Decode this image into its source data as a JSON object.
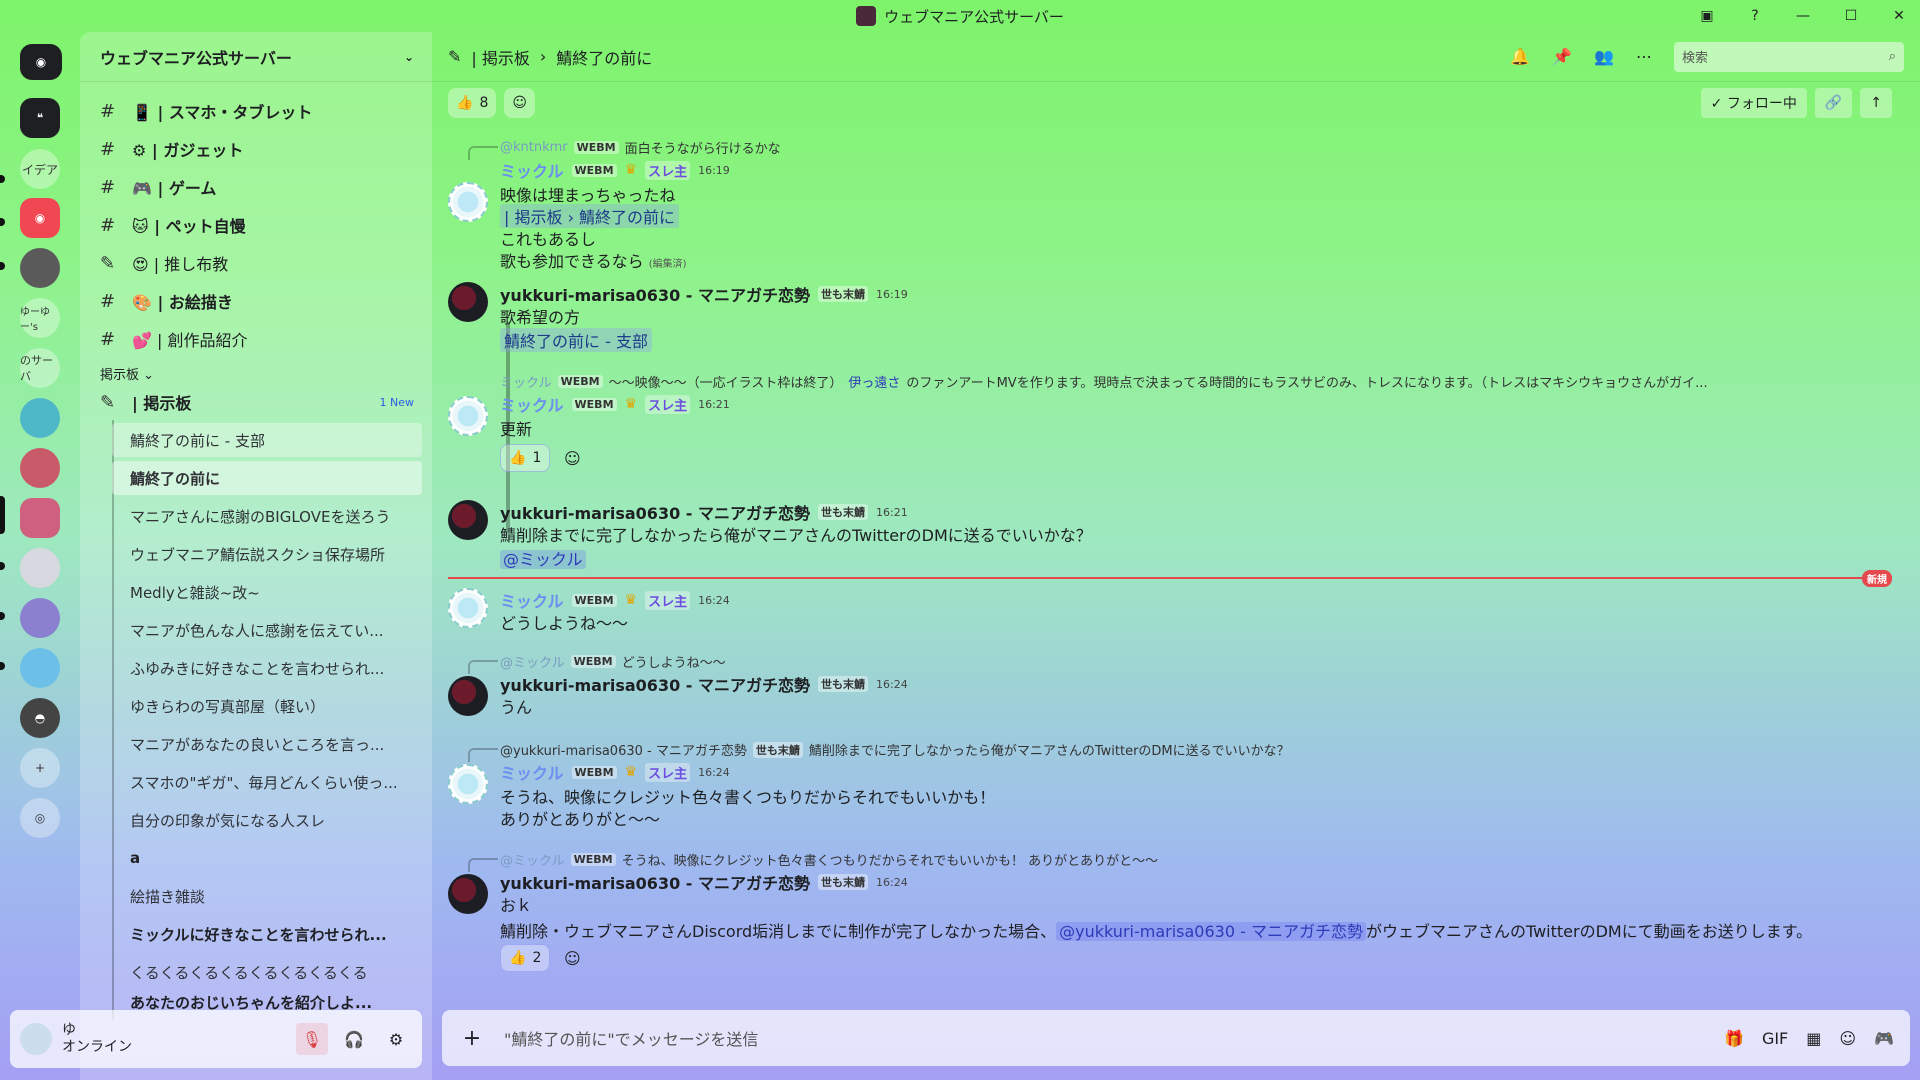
{
  "window": {
    "title": "ウェブマニア公式サーバー"
  },
  "servers": {
    "labels": [
      "イデア",
      "ゆーゆー's",
      "のサーバ"
    ]
  },
  "server": {
    "name": "ウェブマニア公式サーバー"
  },
  "channels": [
    {
      "icon": "#",
      "name": "📱 | スマホ・タブレット"
    },
    {
      "icon": "#",
      "name": "⚙ | ガジェット"
    },
    {
      "icon": "#",
      "name": "🎮 | ゲーム"
    },
    {
      "icon": "#",
      "name": "🐱 | ペット自慢"
    },
    {
      "icon": "forum",
      "name": "😍 | 推し布教"
    },
    {
      "icon": "#",
      "name": "🎨 | お絵描き"
    },
    {
      "icon": "#",
      "name": "💕 | 創作品紹介"
    }
  ],
  "category": "掲示板 ⌄",
  "forum": {
    "name": "| 掲示板",
    "badge": "1 New"
  },
  "threads": [
    "鯖終了の前に - 支部",
    "鯖終了の前に",
    "マニアさんに感謝のBIGLOVEを送ろう",
    "ウェブマニア鯖伝説スクショ保存場所",
    "Medlyと雑談~改~",
    "マニアが色んな人に感謝を伝えてい...",
    "ふゆみきに好きなことを言わせられ...",
    "ゆきらわの写真部屋（軽い）",
    "マニアがあなたの良いところを言っ...",
    "スマホの\"ギガ\"、毎月どんくらい使っ...",
    "自分の印象が気になる人スレ",
    "a",
    "絵描き雑談",
    "ミックルに好きなことを言わせられ...",
    "くるくるくるくるくるくるくるくる",
    "あなたのおじいちゃんを紹介しよ..."
  ],
  "user": {
    "name": "ゆ",
    "status": "オンライン"
  },
  "header": {
    "forum": "| 掲示板",
    "sep": "›",
    "thread": "鯖終了の前に",
    "search_placeholder": "検索"
  },
  "topbar": {
    "like": "👍",
    "like_count": "8",
    "follow": "✓ フォロー中"
  },
  "messages": {
    "m1": {
      "reply_name": "@kntnkmr",
      "reply_tag": "WEBM",
      "reply_text": "面白そうながら行けるかな",
      "name": "ミックル",
      "tag": "WEBM",
      "sure": "スレ主",
      "time": "16:19",
      "l1": "映像は埋まっちゃったね",
      "chip": "| 掲示板 › 鯖終了の前に",
      "l2": "これもあるし",
      "l3": "歌も参加できるなら",
      "edited": "(編集済)"
    },
    "m2": {
      "name": "yukkuri-marisa0630 - マニアガチ恋勢",
      "tag": "世も末鯖",
      "time": "16:19",
      "l1": "歌希望の方",
      "chip": "鯖終了の前に - 支部"
    },
    "m3": {
      "reply_name": "ミックル",
      "reply_tag": "WEBM",
      "reply_text": "〜〜映像〜〜（一応イラスト枠は終了）",
      "reply_link": "伊っ遠さ",
      "reply_rest": "のファンアートMVを作ります。現時点で決まってる時間的にもラスサビのみ、トレスになります。（トレスはマキシウキョウさんがガイ...",
      "name": "ミックル",
      "tag": "WEBM",
      "sure": "スレ主",
      "time": "16:21",
      "l1": "更新",
      "react": "👍",
      "react_count": "1"
    },
    "m4": {
      "name": "yukkuri-marisa0630 - マニアガチ恋勢",
      "tag": "世も末鯖",
      "time": "16:21",
      "l1": "鯖削除までに完了しなかったら俺がマニアさんのTwitterのDMに送るでいいかな？",
      "mention": "@ミックル"
    },
    "new": "新規",
    "m5": {
      "name": "ミックル",
      "tag": "WEBM",
      "sure": "スレ主",
      "time": "16:24",
      "l1": "どうしようね〜〜"
    },
    "m6": {
      "reply_name": "@ミックル",
      "reply_tag": "WEBM",
      "reply_text": "どうしようね〜〜",
      "name": "yukkuri-marisa0630 - マニアガチ恋勢",
      "tag": "世も末鯖",
      "time": "16:24",
      "l1": "うん"
    },
    "m7": {
      "reply_name": "@yukkuri-marisa0630 - マニアガチ恋勢",
      "reply_tag": "世も末鯖",
      "reply_text": "鯖削除までに完了しなかったら俺がマニアさんのTwitterのDMに送るでいいかな？",
      "name": "ミックル",
      "tag": "WEBM",
      "sure": "スレ主",
      "time": "16:24",
      "l1": "そうね、映像にクレジット色々書くつもりだからそれでもいいかも！",
      "l2": "ありがとありがと〜〜"
    },
    "m8": {
      "reply_name": "@ミックル",
      "reply_tag": "WEBM",
      "reply_text": "そうね、映像にクレジット色々書くつもりだからそれでもいいかも！ ありがとありがと〜〜",
      "name": "yukkuri-marisa0630 - マニアガチ恋勢",
      "tag": "世も末鯖",
      "time": "16:24",
      "l1": "おｋ",
      "l2a": "鯖削除・ウェブマニアさんDiscord垢消しまでに制作が完了しなかった場合、",
      "l2m": "@yukkuri-marisa0630 - マニアガチ恋勢",
      "l2b": "がウェブマニアさんのTwitterのDMにて動画をお送りします。",
      "react": "👍",
      "react_count": "2"
    }
  },
  "composer": {
    "placeholder": "\"鯖終了の前に\"でメッセージを送信"
  }
}
